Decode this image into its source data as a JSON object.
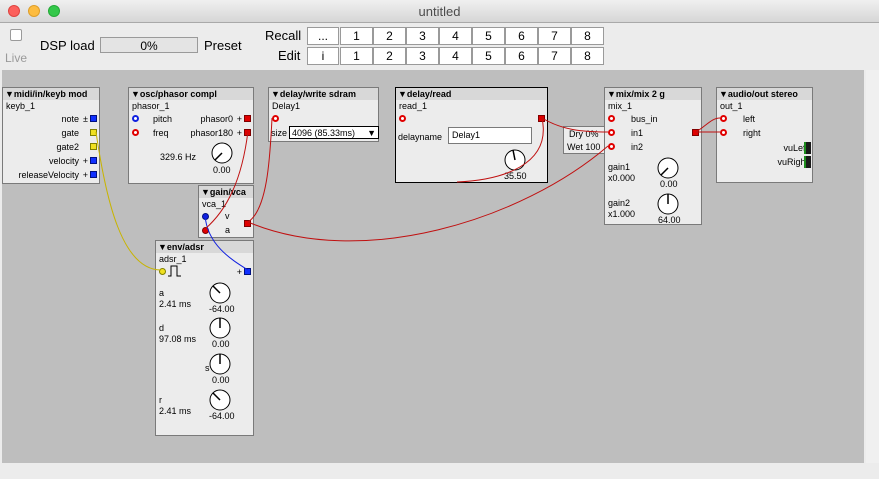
{
  "window": {
    "title": "untitled"
  },
  "toolbar": {
    "live_label": "Live",
    "dsp_label": "DSP load",
    "dsp_value": "0%",
    "preset_label": "Preset",
    "recall_label": "Recall",
    "edit_label": "Edit",
    "recall_buttons": [
      "...",
      "1",
      "2",
      "3",
      "4",
      "5",
      "6",
      "7",
      "8"
    ],
    "edit_buttons": [
      "i",
      "1",
      "2",
      "3",
      "4",
      "5",
      "6",
      "7",
      "8"
    ]
  },
  "objects": {
    "keyb": {
      "type": "▼midi/in/keyb mod",
      "name": "keyb_1",
      "outlets": [
        {
          "label": "note",
          "sym": "±"
        },
        {
          "label": "gate",
          "sym": ""
        },
        {
          "label": "gate2",
          "sym": ""
        },
        {
          "label": "velocity",
          "sym": "+"
        },
        {
          "label": "releaseVelocity",
          "sym": "+"
        }
      ]
    },
    "phasor": {
      "type": "▼osc/phasor compl",
      "name": "phasor_1",
      "in1": "pitch",
      "in2": "freq",
      "out1": "phasor0",
      "out2": "phasor180",
      "out_sym": "+",
      "freq_value": "329.6 Hz",
      "knob_value": "0.00"
    },
    "dwrite": {
      "type": "▼delay/write sdram",
      "name": "Delay1",
      "size_label": "size",
      "size_value": "4096 (85.33ms)"
    },
    "dread": {
      "type": "▼delay/read",
      "name": "read_1",
      "delayname_label": "delayname",
      "delayname_value": "Delay1",
      "knob_value": "35.50"
    },
    "mix": {
      "type": "▼mix/mix 2 g",
      "name": "mix_1",
      "inputs": [
        "bus_in",
        "in1",
        "in2"
      ],
      "gain1_label": "gain1",
      "gain1_value": "x0.000",
      "knob1_value": "0.00",
      "gain2_label": "gain2",
      "gain2_value": "x1.000",
      "knob2_value": "64.00"
    },
    "out": {
      "type": "▼audio/out stereo",
      "name": "out_1",
      "inputs": [
        "left",
        "right"
      ],
      "vu_left": "vuLeft",
      "vu_right": "vuRight"
    },
    "vca": {
      "type": "▼gain/vca",
      "name": "vca_1",
      "in1": "v",
      "in2": "a"
    },
    "adsr": {
      "type": "▼env/adsr",
      "name": "adsr_1",
      "params": [
        {
          "label": "a",
          "value": "2.41 ms",
          "knob": "-64.00"
        },
        {
          "label": "d",
          "value": "97.08 ms",
          "knob": "0.00"
        },
        {
          "label": "s",
          "value": "",
          "knob": "0.00"
        },
        {
          "label": "r",
          "value": "2.41 ms",
          "knob": "-64.00"
        }
      ]
    }
  },
  "drywet": {
    "dry": "Dry 0%",
    "wet": "Wet 100"
  },
  "colors": {
    "canvas": "#bebebe",
    "audio_wire": "#c01010",
    "control_wire": "#1020e0",
    "gate_wire": "#c8b400"
  }
}
